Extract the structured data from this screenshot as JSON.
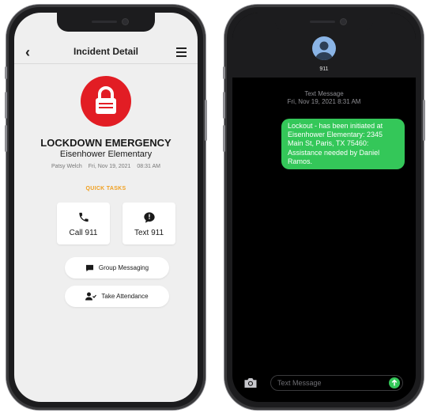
{
  "colors": {
    "accent_red": "#e21d24",
    "quick_tasks_orange": "#f0a020",
    "imessage_green": "#34c759"
  },
  "incident": {
    "nav_title": "Incident Detail",
    "back_icon": "chevron-left-icon",
    "menu_icon": "hamburger-menu-icon",
    "status_icon": "lock-icon",
    "emergency_title": "LOCKDOWN EMERGENCY",
    "school_name": "Eisenhower Elementary",
    "reporter": "Patsy Welch",
    "date": "Fri, Nov 19, 2021",
    "time": "08:31 AM",
    "quick_tasks_label": "QUICK TASKS",
    "tiles": [
      {
        "label": "Call 911",
        "icon": "phone-icon"
      },
      {
        "label": "Text 911",
        "icon": "message-alert-icon"
      }
    ],
    "actions": [
      {
        "label": "Group Messaging",
        "icon": "chat-icon"
      },
      {
        "label": "Take Attendance",
        "icon": "user-check-icon"
      }
    ]
  },
  "messages": {
    "contact_name": "911",
    "contact_icon": "person-avatar-icon",
    "thread_type": "Text Message",
    "thread_timestamp": "Fri, Nov 19, 2021 8:31 AM",
    "bubble_text": "Lockout - has been initiated at Eisenhower Elementary: 2345 Main St, Paris, TX 75460: Assistance needed by Daniel Ramos.",
    "input_placeholder": "Text Message",
    "camera_icon": "camera-icon",
    "send_icon": "arrow-up-icon"
  }
}
